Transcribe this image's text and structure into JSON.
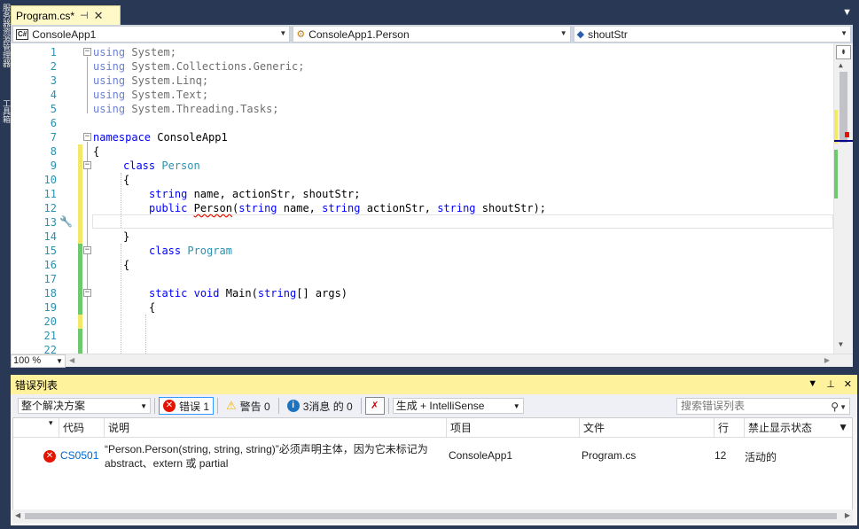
{
  "side_strip": {
    "labels": [
      "服务器资源管理器",
      "工具箱"
    ]
  },
  "tab": {
    "title": "Program.cs*",
    "pin": "⊣",
    "close": "✕"
  },
  "navbar": {
    "project": "ConsoleApp1",
    "type": "ConsoleApp1.Person",
    "member": "shoutStr",
    "project_icon": "C#"
  },
  "editor": {
    "line_numbers": [
      "1",
      "2",
      "3",
      "4",
      "5",
      "6",
      "7",
      "8",
      "9",
      "10",
      "11",
      "12",
      "13",
      "14",
      "15",
      "16",
      "17",
      "18",
      "19",
      "20",
      "21",
      "22"
    ],
    "lines": [
      [
        "using System;"
      ],
      [
        "using System.Collections.Generic;"
      ],
      [
        "using System.Linq;"
      ],
      [
        "using System.Text;"
      ],
      [
        "using System.Threading.Tasks;"
      ],
      [
        ""
      ],
      [
        "namespace ConsoleApp1"
      ],
      [
        "{"
      ],
      [
        "    class Person"
      ],
      [
        "    {"
      ],
      [
        "        string name, actionStr, shoutStr;"
      ],
      [
        "        public Person(string name, string actionStr, string shoutStr);"
      ],
      [
        ""
      ],
      [
        "    }"
      ],
      [
        "        class Program"
      ],
      [
        "    {"
      ],
      [
        ""
      ],
      [
        "        static void Main(string[] args)"
      ],
      [
        "        {"
      ],
      [
        ""
      ],
      [
        ""
      ],
      [
        ""
      ]
    ],
    "line1_kw": "using",
    "line1_rest": " System;",
    "line2_kw": "using",
    "line2_rest": " System.Collections.Generic;",
    "line3_kw": "using",
    "line3_rest": " System.Linq;",
    "line4_kw": "using",
    "line4_rest": " System.Text;",
    "line5_kw": "using",
    "line5_rest": " System.Threading.Tasks;",
    "line7_kw": "namespace",
    "line7_rest": " ConsoleApp1",
    "line8": "{",
    "line9_kw": "class",
    "line9_ty": "Person",
    "line10": "{",
    "line11_kw": "string",
    "line11_rest": " name, actionStr, shoutStr;",
    "line12_kw": "public",
    "line12_err": "Person",
    "line12_p1": "(",
    "line12_t1": "string",
    "line12_p2": " name, ",
    "line12_t2": "string",
    "line12_p3": " actionStr, ",
    "line12_t3": "string",
    "line12_p4": " shoutStr);",
    "line14": "}",
    "line15_kw": "class",
    "line15_ty": "Program",
    "line16": "{",
    "line18_kw1": "static",
    "line18_kw2": "void",
    "line18_rest1": " Main(",
    "line18_kw3": "string",
    "line18_rest2": "[] args)",
    "line19": "{"
  },
  "zoom": {
    "value": "100 %"
  },
  "error_list": {
    "title": "错误列表",
    "scope": "整个解决方案",
    "errors_label": "错误 1",
    "warnings_label": "警告 0",
    "messages_label": "3消息 的 0",
    "build_filter": "生成 + IntelliSense",
    "search_placeholder": "搜索错误列表",
    "columns": {
      "code": "代码",
      "description": "说明",
      "project": "项目",
      "file": "文件",
      "line": "行",
      "suppression": "禁止显示状态"
    },
    "rows": [
      {
        "code": "CS0501",
        "description_line1": "“Person.Person(string, string, string)”必须声明主体，因为它未标记为",
        "description_line2": "abstract、extern 或 partial",
        "project": "ConsoleApp1",
        "file": "Program.cs",
        "line": "12",
        "suppression": "活动的"
      }
    ]
  },
  "colors": {
    "accent": "#293955",
    "tab_active": "#fff9c7",
    "error_header": "#fff29d",
    "error_red": "#e51400"
  }
}
